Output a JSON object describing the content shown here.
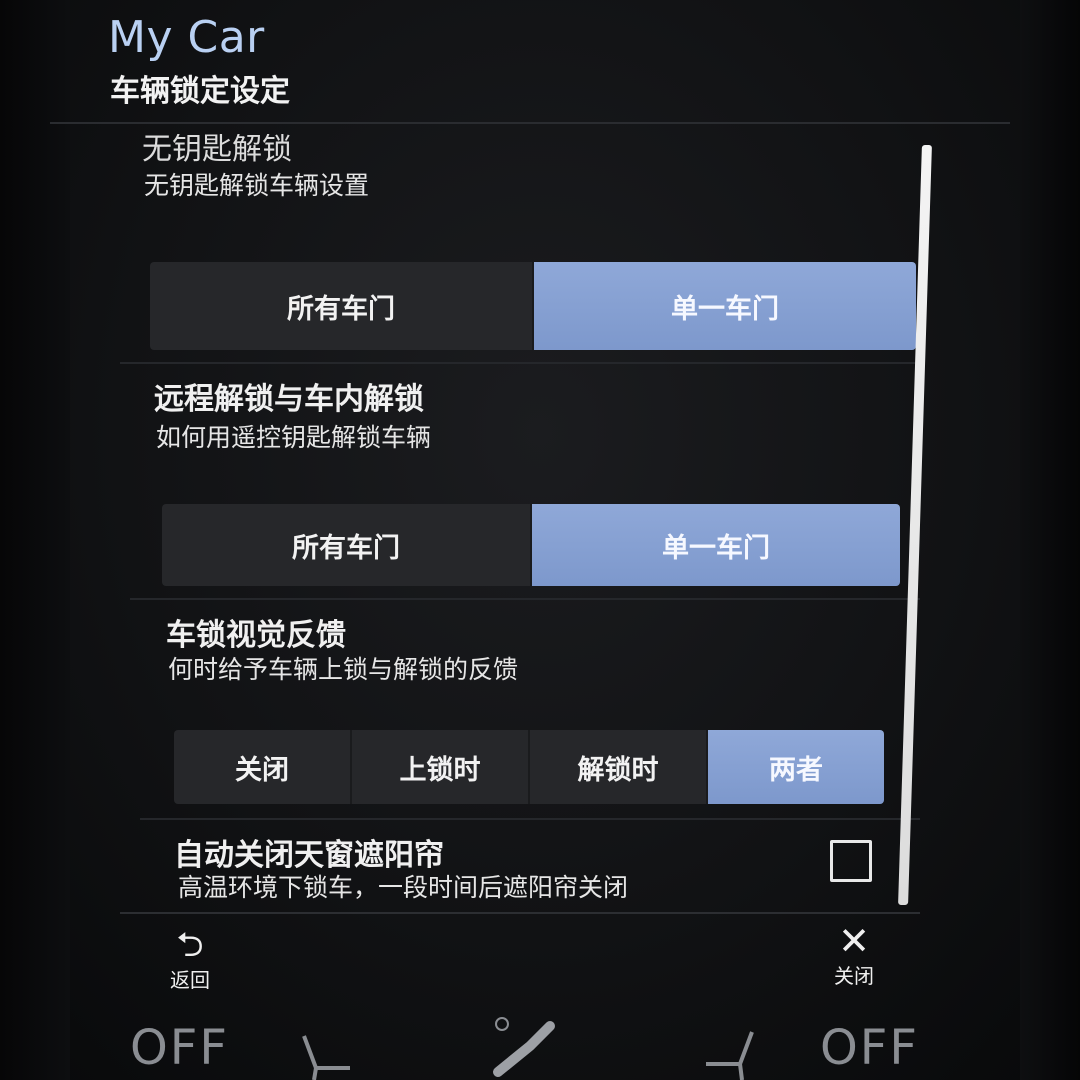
{
  "header": {
    "title": "My Car",
    "subtitle": "车辆锁定设定"
  },
  "sections": {
    "keyless": {
      "title": "无钥匙解锁",
      "desc": "无钥匙解锁车辆设置",
      "options": [
        "所有车门",
        "单一车门"
      ],
      "selected": "单一车门"
    },
    "remote": {
      "title": "远程解锁与车内解锁",
      "desc": "如何用遥控钥匙解锁车辆",
      "options": [
        "所有车门",
        "单一车门"
      ],
      "selected": "单一车门"
    },
    "feedback": {
      "title": "车锁视觉反馈",
      "desc": "何时给予车辆上锁与解锁的反馈",
      "options": [
        "关闭",
        "上锁时",
        "解锁时",
        "两者"
      ],
      "selected": "两者"
    },
    "sunshade": {
      "title": "自动关闭天窗遮阳帘",
      "desc": "高温环境下锁车，一段时间后遮阳帘关闭",
      "checked": false
    }
  },
  "nav": {
    "back_label": "返回",
    "close_label": "关闭"
  },
  "climate": {
    "left": "OFF",
    "right": "OFF"
  },
  "colors": {
    "accent": "#8fa8d8",
    "title": "#b9d0f2"
  }
}
